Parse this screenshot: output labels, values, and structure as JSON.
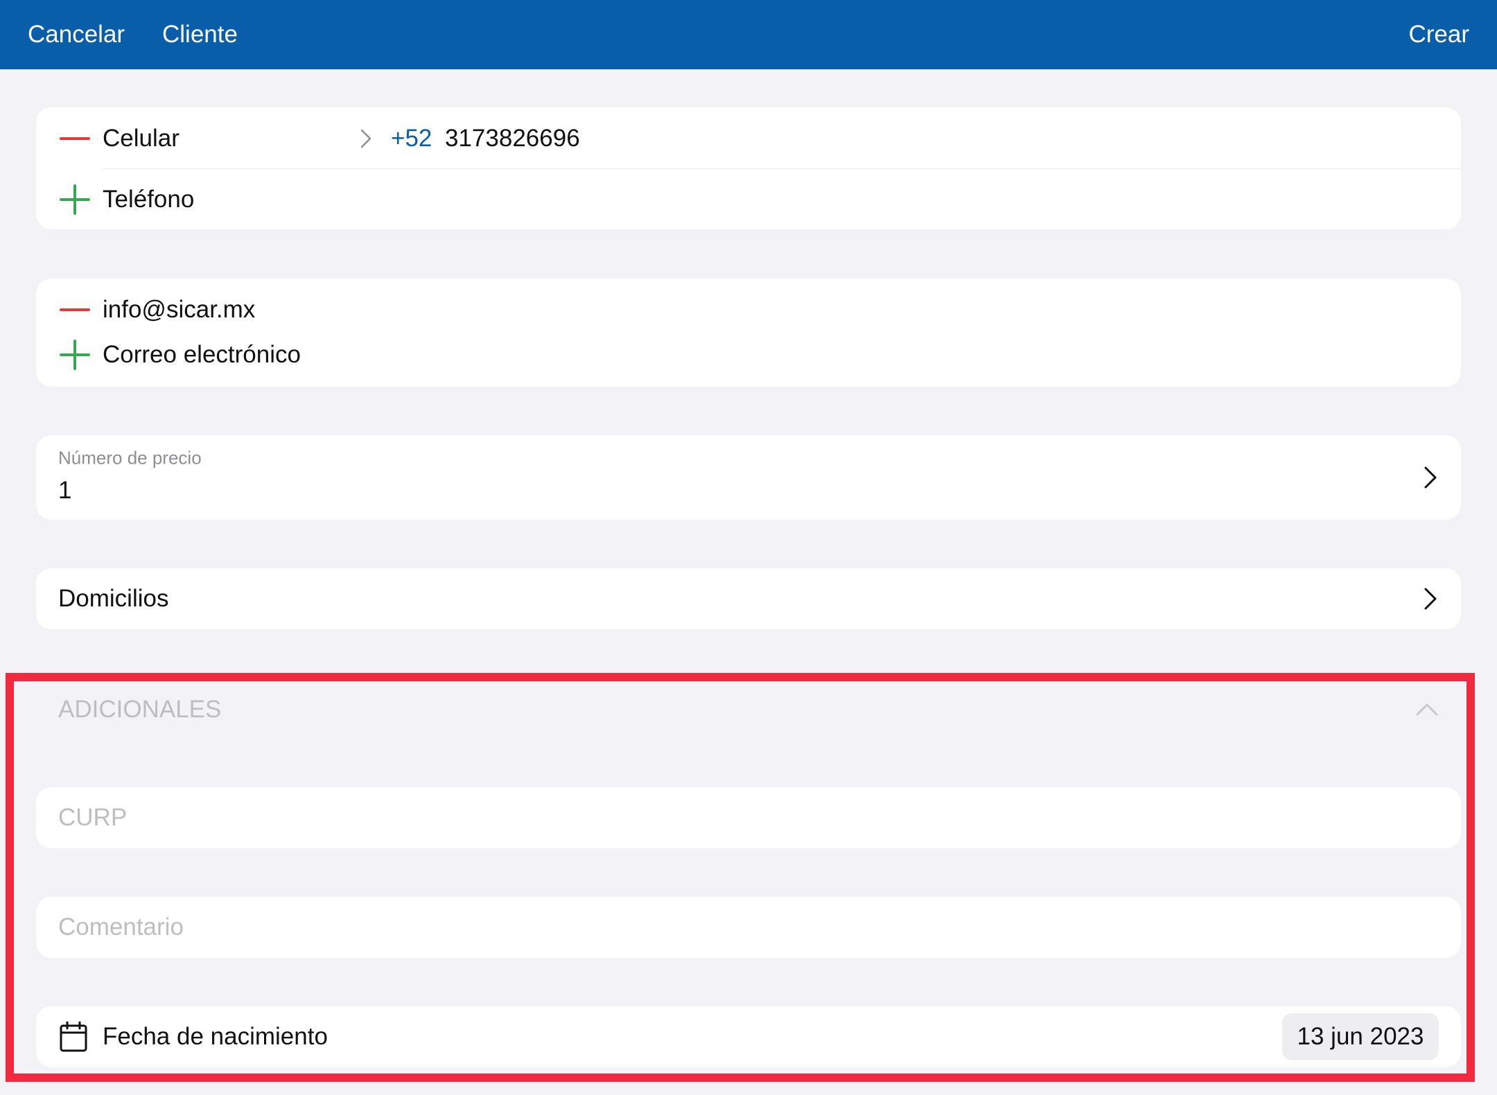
{
  "header": {
    "cancel_label": "Cancelar",
    "title": "Cliente",
    "create_label": "Crear",
    "background_color": "#095ea9"
  },
  "phones": {
    "mobile_label": "Celular",
    "country_code": "+52",
    "mobile_number": "3173826696",
    "add_phone_label": "Teléfono"
  },
  "emails": {
    "email_value": "info@sicar.mx",
    "add_email_label": "Correo electrónico"
  },
  "price": {
    "label": "Número de precio",
    "value": "1"
  },
  "addresses": {
    "label": "Domicilios"
  },
  "additional": {
    "section_title": "ADICIONALES",
    "curp_placeholder": "CURP",
    "comment_placeholder": "Comentario",
    "birthdate_label": "Fecha de nacimiento",
    "birthdate_value": "13 jun 2023"
  },
  "colors": {
    "remove": "#e53935",
    "add": "#34a853",
    "link": "#095ea9",
    "highlight": "#f2293f"
  },
  "icons": {
    "remove": "minus-icon",
    "add": "plus-icon",
    "disclosure": "chevron-right-icon",
    "collapse": "chevron-up-icon",
    "calendar": "calendar-icon"
  }
}
